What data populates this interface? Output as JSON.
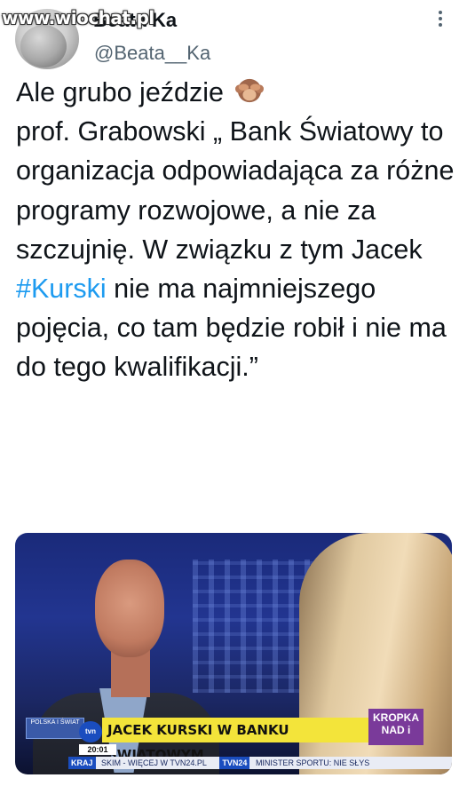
{
  "watermark": "www.wiochat.pl",
  "author": {
    "display_name": "Beata Ka",
    "handle": "@Beata__Ka"
  },
  "more_icon": "more-vertical-icon",
  "tweet": {
    "text_before": "Ale grubo jeździe ",
    "emoji": "see-no-evil-monkey",
    "text_line2": "\nprof. Grabowski „ Bank Światowy to organizacja odpowiadająca za różne programy rozwojowe, a nie za szczujnię. W związku z tym Jacek ",
    "hashtag": "#Kurski",
    "text_after": " nie ma najmniejszego pojęcia, co tam będzie robił i nie ma do tego kwalifikacji.”"
  },
  "media": {
    "channel_pill": "POLSKA I ŚWIAT",
    "logo": "tvn",
    "headline": "JACEK KURSKI W BANKU ŚWIATOWYM",
    "program": "KROPKA NAD i",
    "time": "20:01",
    "ticker_label": "KRAJ",
    "ticker_text": "SKIM - WIĘCEJ W TVN24.PL",
    "ticker_label2": "TVN24",
    "ticker_text2": "MINISTER SPORTU: NIE SŁYS"
  }
}
